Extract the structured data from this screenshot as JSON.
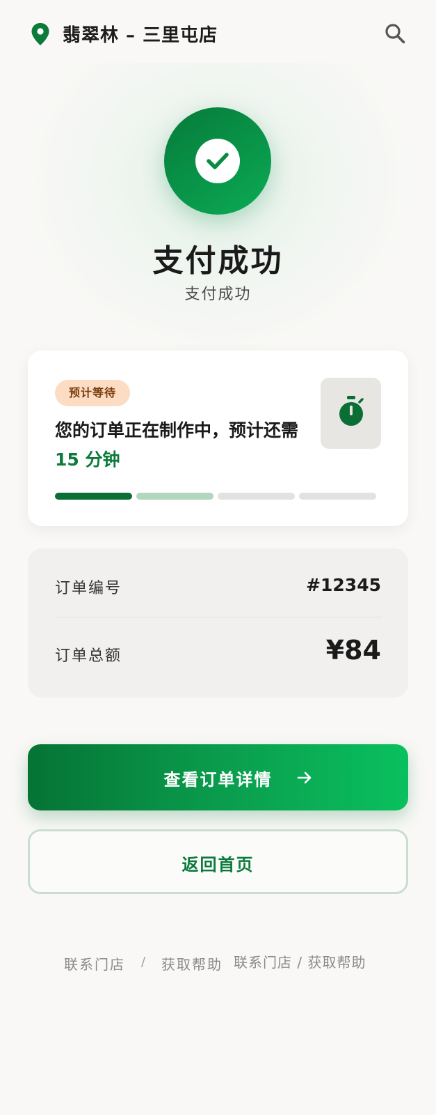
{
  "header": {
    "store_name": "翡翠林 – 三里屯店",
    "location_icon": "location-pin-icon",
    "search_icon": "search-icon"
  },
  "hero": {
    "icon": "check-circle-icon",
    "title": "支付成功",
    "subtitle": "支付成功"
  },
  "wait_card": {
    "badge": "预计等待",
    "message_prefix": "您的订单正在制作中，预计还需",
    "minutes": "15 分钟",
    "icon": "stopwatch-icon",
    "progress_steps_total": 4,
    "progress_steps_done": 1,
    "progress_steps_active": 1
  },
  "order": {
    "number_label": "订单编号",
    "number_value": "#12345",
    "total_label": "订单总额",
    "total_value": "¥84"
  },
  "actions": {
    "primary_label": "查看订单详情",
    "primary_icon": "arrow-right-icon",
    "secondary_label": "返回首页"
  },
  "footer": {
    "contact_store": "联系门店",
    "separator": "/",
    "get_help": "获取帮助",
    "combined": "联系门店 / 获取帮助"
  },
  "colors": {
    "brand_green": "#0b7a3b",
    "badge_bg": "#fcdcc2",
    "badge_text": "#7a3d10",
    "progress_done": "#0b6e35",
    "progress_active": "#b3d6bf",
    "progress_pending": "#e4e2e0"
  }
}
